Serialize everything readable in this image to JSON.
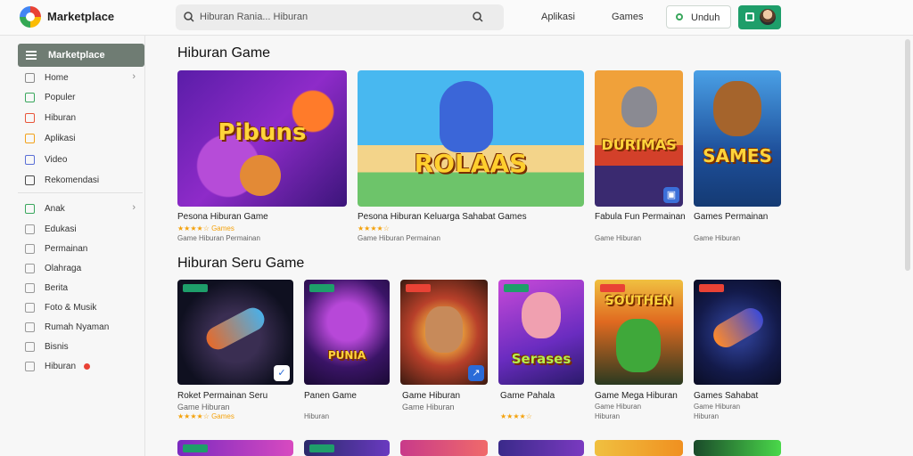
{
  "header": {
    "brand": "Marketplace",
    "search_placeholder": "Hiburan Rania... Hiburan",
    "links": [
      "Aplikasi",
      "Games"
    ],
    "outline_button": "Unduh"
  },
  "sidebar": {
    "active": "Marketplace",
    "items": [
      {
        "label": "Home",
        "icon": "home-icon",
        "color": "#8a8a8a",
        "chevron": true
      },
      {
        "label": "Populer",
        "icon": "star-icon",
        "color": "#3aa75d"
      },
      {
        "label": "Hiburan",
        "icon": "film-icon",
        "color": "#e8553a"
      },
      {
        "label": "Aplikasi",
        "icon": "apps-icon",
        "color": "#f2a21c"
      },
      {
        "label": "Video",
        "icon": "video-icon",
        "color": "#5a6fd6"
      },
      {
        "label": "Rekomendasi",
        "icon": "list-icon",
        "color": "#4a4a4a"
      },
      {
        "label": "Anak",
        "icon": "kids-icon",
        "color": "#3aa75d",
        "chevron": true
      },
      {
        "label": "Edukasi",
        "icon": "book-icon",
        "color": "#999"
      },
      {
        "label": "Permainan",
        "icon": "gamepad-icon",
        "color": "#999"
      },
      {
        "label": "Olahraga",
        "icon": "ball-icon",
        "color": "#999"
      },
      {
        "label": "Berita",
        "icon": "news-icon",
        "color": "#999"
      },
      {
        "label": "Foto & Musik",
        "icon": "music-icon",
        "color": "#999"
      },
      {
        "label": "Rumah Nyaman",
        "icon": "house-icon",
        "color": "#999"
      },
      {
        "label": "Bisnis",
        "icon": "briefcase-icon",
        "color": "#999"
      },
      {
        "label": "Hiburan",
        "icon": "ticket-icon",
        "color": "#999",
        "badge": true
      }
    ]
  },
  "section1": {
    "title": "Hiburan Game",
    "cards": [
      {
        "art_title": "Pibuns",
        "caption": "Pesona Hiburan Game",
        "rating": "★★★★☆ Games",
        "sub": "Game Hiburan Permainan"
      },
      {
        "art_title": "ROLAAS",
        "caption": "Pesona Hiburan Keluarga Sahabat Games",
        "rating": "★★★★☆",
        "sub": "Game Hiburan Permainan"
      },
      {
        "art_title": "DURIMAS",
        "caption": "Fabula Fun Permainan",
        "rating": "",
        "sub": "Game Hiburan"
      },
      {
        "art_title": "SAMES",
        "caption": "Games Permainan",
        "rating": "",
        "sub": "Game Hiburan"
      }
    ]
  },
  "section2": {
    "title": "Hiburan Seru Game",
    "cards": [
      {
        "art_title": "",
        "caption": "Roket Permainan Seru",
        "rating": "Game Hiburan",
        "sub": "★★★★☆ Games"
      },
      {
        "art_title": "PUNIA",
        "caption": "Panen Game",
        "rating": "",
        "sub": "Hiburan"
      },
      {
        "art_title": "",
        "caption": "Game Hiburan",
        "rating": "Game Hiburan",
        "sub": ""
      },
      {
        "art_title": "Serases",
        "caption": "Game Pahala",
        "rating": "★★★★☆",
        "sub": ""
      },
      {
        "art_title": "SOUTHEN",
        "caption": "Game Mega Hiburan",
        "rating": "Game Hiburan",
        "sub": "Hiburan"
      },
      {
        "art_title": "",
        "caption": "Games Sahabat",
        "rating": "Game Hiburan",
        "sub": "Hiburan"
      }
    ]
  }
}
